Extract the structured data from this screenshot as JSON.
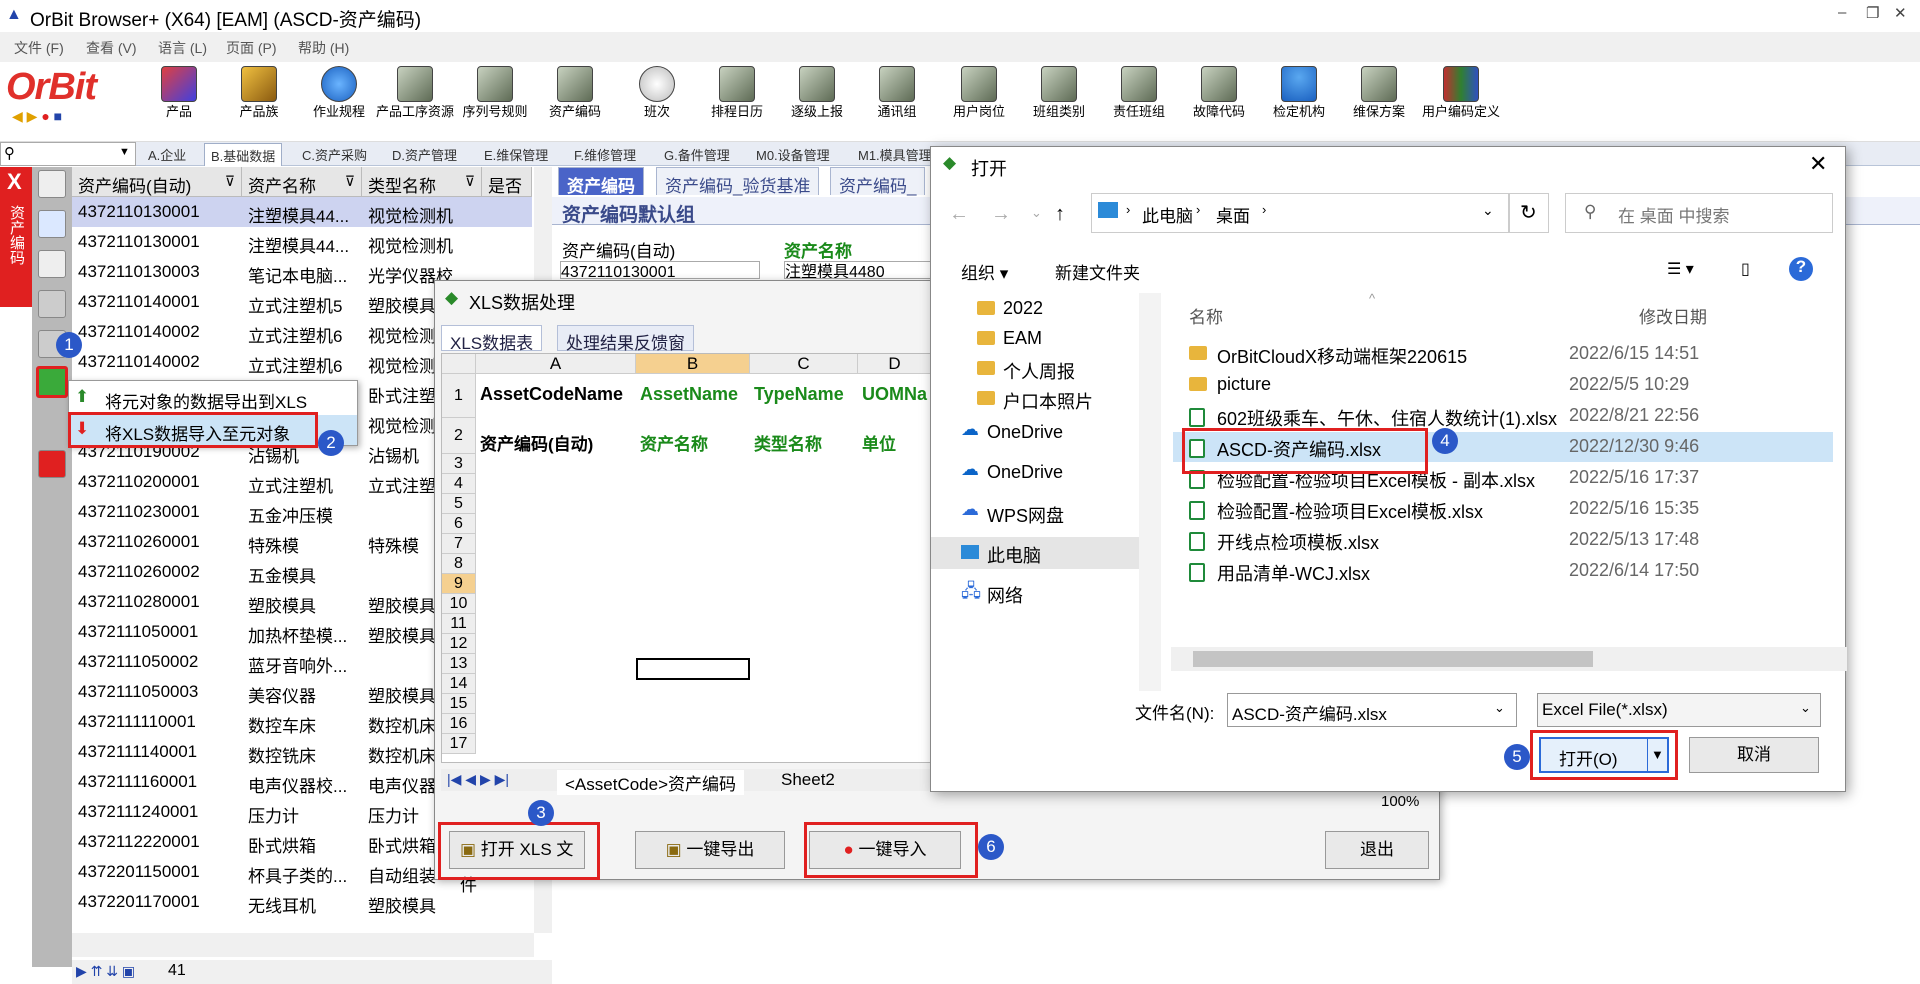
{
  "window": {
    "title": "OrBit Browser+ (X64) [EAM] (ASCD-资产编码)"
  },
  "menu": [
    "文件 (F)",
    "查看 (V)",
    "语言 (L)",
    "页面 (P)",
    "帮助 (H)"
  ],
  "logo": "OrBit",
  "toolbar": [
    "产品",
    "产品族",
    "作业规程",
    "产品工序资源",
    "序列号规则",
    "资产编码",
    "班次",
    "排程日历",
    "逐级上报",
    "通讯组",
    "用户岗位",
    "班组类别",
    "责任班组",
    "故障代码",
    "检定机构",
    "维保方案",
    "用户编码定义"
  ],
  "module_tabs": [
    "A.企业",
    "B.基础数据",
    "C.资产采购",
    "D.资产管理",
    "E.维保管理",
    "F.维修管理",
    "G.备件管理",
    "M0.设备管理",
    "M1.模具管理"
  ],
  "left_strip": {
    "close": "X",
    "label": "资产编码"
  },
  "grid": {
    "headers": [
      "资产编码(自动)",
      "资产名称",
      "类型名称",
      "是否"
    ],
    "rows": [
      [
        "4372110130001",
        "注塑模具44...",
        "视觉检测机"
      ],
      [
        "4372110130001",
        "注塑模具44...",
        "视觉检测机"
      ],
      [
        "4372110130003",
        "笔记本电脑...",
        "光学仪器校..."
      ],
      [
        "4372110140001",
        "立式注塑机5",
        "塑胶模具"
      ],
      [
        "4372110140002",
        "立式注塑机6",
        "视觉检测"
      ],
      [
        "4372110140002",
        "立式注塑机6",
        "视觉检测"
      ],
      [
        "",
        "",
        "卧式注塑"
      ],
      [
        "",
        "",
        "视觉检测"
      ],
      [
        "4372110190002",
        "沾锡机",
        "沾锡机"
      ],
      [
        "4372110200001",
        "立式注塑机",
        "立式注塑"
      ],
      [
        "4372110230001",
        "五金冲压模",
        ""
      ],
      [
        "4372110260001",
        "特殊模",
        "特殊模"
      ],
      [
        "4372110260002",
        "五金模具",
        ""
      ],
      [
        "4372110280001",
        "塑胶模具",
        "塑胶模具"
      ],
      [
        "4372111050001",
        "加热杯垫模...",
        "塑胶模具"
      ],
      [
        "4372111050002",
        "蓝牙音响外...",
        ""
      ],
      [
        "4372111050003",
        "美容仪器",
        "塑胶模具"
      ],
      [
        "4372111110001",
        "数控车床",
        "数控机床"
      ],
      [
        "4372111140001",
        "数控铣床",
        "数控机床"
      ],
      [
        "4372111160001",
        "电声仪器校...",
        "电声仪器"
      ],
      [
        "4372111240001",
        "压力计",
        "压力计"
      ],
      [
        "4372112220001",
        "卧式烘箱",
        "卧式烘箱"
      ],
      [
        "4372201150001",
        "杯具子类的...",
        "自动组装"
      ],
      [
        "4372201170001",
        "无线耳机",
        "塑胶模具"
      ]
    ],
    "count": "41"
  },
  "context_menu": [
    "将元对象的数据导出到XLS",
    "将XLS数据导入至元对象"
  ],
  "right": {
    "tabs": [
      "资产编码",
      "资产编码_验货基准",
      "资产编码_"
    ],
    "section": "资产编码默认组",
    "field1_label": "资产编码(自动)",
    "field2_label": "资产名称",
    "field1_value": "4372110130001",
    "field2_value": "注塑模具4480"
  },
  "xls": {
    "title": "XLS数据处理",
    "tabs": [
      "XLS数据表",
      "处理结果反馈窗"
    ],
    "columns": [
      "A",
      "B",
      "C",
      "D"
    ],
    "row1": [
      "AssetCodeName",
      "AssetName",
      "TypeName",
      "UOMNa"
    ],
    "row2": [
      "资产编码(自动)",
      "资产名称",
      "类型名称",
      "单位"
    ],
    "rownums": [
      "1",
      "2",
      "3",
      "4",
      "5",
      "6",
      "7",
      "8",
      "9",
      "10",
      "11",
      "12",
      "13",
      "14",
      "15",
      "16",
      "17"
    ],
    "sheets": [
      "<AssetCode>资产编码",
      "Sheet2"
    ],
    "zoom": "100%",
    "buttons": {
      "open": "打开 XLS 文件",
      "export": "一键导出",
      "import": "一键导入",
      "exit": "退出"
    }
  },
  "open_dialog": {
    "title": "打开",
    "path": [
      "此电脑",
      "桌面"
    ],
    "search_placeholder": "在 桌面 中搜索",
    "organize": "组织",
    "new_folder": "新建文件夹",
    "nav": [
      "2022",
      "EAM",
      "个人周报",
      "户口本照片",
      "OneDrive",
      "OneDrive",
      "WPS网盘",
      "此电脑",
      "网络"
    ],
    "col_name": "名称",
    "col_date": "修改日期",
    "files": [
      {
        "name": "OrBitCloudX移动端框架220615",
        "date": "2022/6/15 14:51",
        "type": "folder"
      },
      {
        "name": "picture",
        "date": "2022/5/5 10:29",
        "type": "folder"
      },
      {
        "name": "602班级乘车、午休、住宿人数统计(1).xlsx",
        "date": "2022/8/21 22:56",
        "type": "xlsx"
      },
      {
        "name": "ASCD-资产编码.xlsx",
        "date": "2022/12/30 9:46",
        "type": "xlsx"
      },
      {
        "name": "检验配置-检验项目Excel模板 - 副本.xlsx",
        "date": "2022/5/16 17:37",
        "type": "xlsx"
      },
      {
        "name": "检验配置-检验项目Excel模板.xlsx",
        "date": "2022/5/16 15:35",
        "type": "xlsx"
      },
      {
        "name": "开线点检项模板.xlsx",
        "date": "2022/5/13 17:48",
        "type": "xlsx"
      },
      {
        "name": "用品清单-WCJ.xlsx",
        "date": "2022/6/14 17:50",
        "type": "xlsx"
      }
    ],
    "filename_label": "文件名(N):",
    "filename_value": "ASCD-资产编码.xlsx",
    "filter": "Excel File(*.xlsx)",
    "open_btn": "打开(O)",
    "cancel_btn": "取消"
  },
  "badges": [
    "1",
    "2",
    "3",
    "4",
    "5",
    "6"
  ],
  "colors": {
    "accent_red": "#e02020",
    "badge_blue": "#2b58c8",
    "selection": "#cce4f7"
  }
}
